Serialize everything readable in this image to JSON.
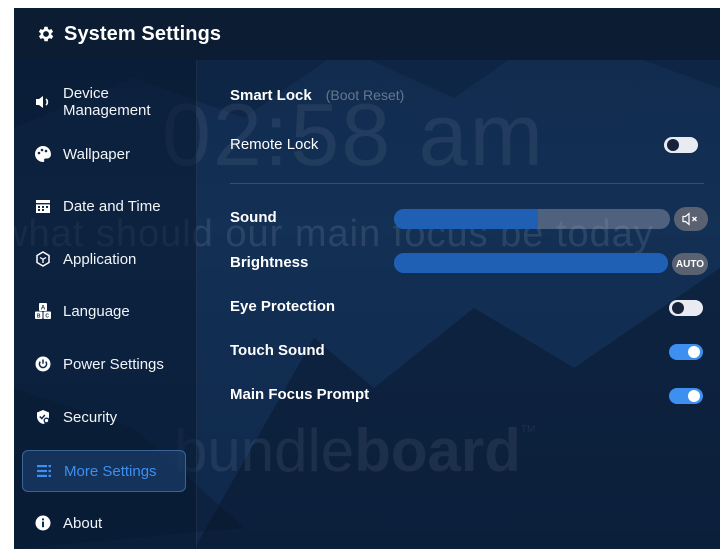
{
  "window": {
    "title": "System Settings",
    "icon": "gear-icon"
  },
  "sidebar": {
    "items": [
      {
        "label": "Device\nManagement",
        "icon": "speaker-icon",
        "active": false
      },
      {
        "label": "Wallpaper",
        "icon": "palette-icon",
        "active": false
      },
      {
        "label": "Date and Time",
        "icon": "calendar-icon",
        "active": false
      },
      {
        "label": "Application",
        "icon": "application-icon",
        "active": false
      },
      {
        "label": "Language",
        "icon": "language-icon",
        "active": false
      },
      {
        "label": "Power Settings",
        "icon": "power-icon",
        "active": false
      },
      {
        "label": "Security",
        "icon": "security-icon",
        "active": false
      },
      {
        "label": "More Settings",
        "icon": "list-icon",
        "active": true
      },
      {
        "label": "About",
        "icon": "info-icon",
        "active": false
      }
    ]
  },
  "background": {
    "clock": "02:58 am",
    "prompt": "what should our main focus be today",
    "brand_light": "bundle",
    "brand_bold": "board",
    "brand_tm": "TM"
  },
  "settings": {
    "smart_lock": {
      "label": "Smart Lock",
      "sub": "(Boot Reset)"
    },
    "remote_lock": {
      "label": "Remote Lock",
      "on": false
    },
    "sound": {
      "label": "Sound",
      "level_pct": 52,
      "mute_icon": "mute-icon"
    },
    "brightness": {
      "label": "Brightness",
      "level_pct": 100,
      "auto_label": "AUTO"
    },
    "eye_protection": {
      "label": "Eye Protection",
      "on": false
    },
    "touch_sound": {
      "label": "Touch Sound",
      "on": true
    },
    "main_focus_prompt": {
      "label": "Main Focus Prompt",
      "on": true
    }
  },
  "colors": {
    "accent": "#3d8ff0",
    "background": "#0f2a4c",
    "titlebar": "#0b1c33"
  }
}
